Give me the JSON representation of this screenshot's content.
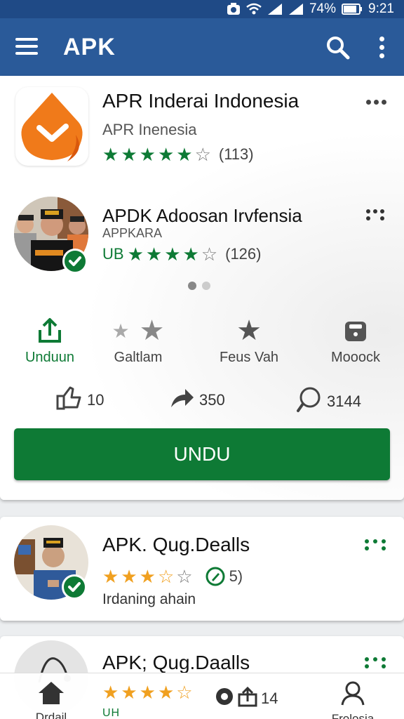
{
  "status_bar": {
    "battery_percent": "74%",
    "time": "9:21"
  },
  "app_bar": {
    "title": "APK"
  },
  "featured": [
    {
      "name": "APR Inderai Indonesia",
      "developer": "APR Inenesia",
      "rating": 5,
      "rating_count": "(113)"
    },
    {
      "name": "APDK Adoosan Irvfensia",
      "developer": "APPKARA",
      "rating_prefix": "UB",
      "rating": 4,
      "rating_count": "(126)"
    }
  ],
  "actions": [
    {
      "label": "Unduun",
      "icon": "share-icon"
    },
    {
      "label": "Galtlam",
      "icon": "stars-icon"
    },
    {
      "label": "Feus Vah",
      "icon": "star-icon"
    },
    {
      "label": "Mooock",
      "icon": "wallet-icon"
    }
  ],
  "stats": {
    "likes": "10",
    "shares": "350",
    "comments": "3144"
  },
  "download_button": "UNDU",
  "list": [
    {
      "name": "APK. Qug.Dealls",
      "rating": 3.5,
      "rating_count": "5)",
      "description": "Irdaning ahain"
    },
    {
      "name": "APK; Qug.Daalls",
      "rating": 4.5,
      "rating_sub": "UH"
    }
  ],
  "bottom_nav": [
    {
      "label": "Drdail",
      "icon": "home-icon"
    },
    {
      "label": "14",
      "icon": "upload-icon"
    },
    {
      "label": "Frolosia",
      "icon": "profile-icon"
    }
  ],
  "colors": {
    "app_bar": "#2a5a99",
    "status_bar": "#1f4a86",
    "accent_green": "#0e7a35",
    "star_orange": "#f0a020",
    "logo_orange": "#f07a1a"
  }
}
